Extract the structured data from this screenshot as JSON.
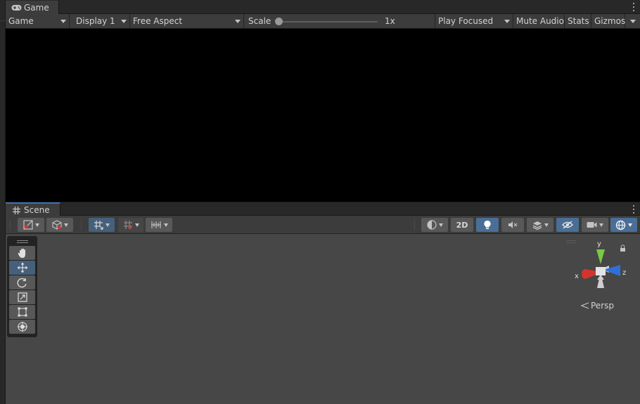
{
  "game": {
    "tab_label": "Game",
    "toolbar": {
      "view_mode": "Game",
      "display": "Display 1",
      "aspect": "Free Aspect",
      "scale_label": "Scale",
      "scale_value": "1x",
      "play_mode": "Play Focused",
      "mute_audio": "Mute Audio",
      "stats": "Stats",
      "gizmos": "Gizmos"
    }
  },
  "scene": {
    "tab_label": "Scene",
    "toolbar": {
      "mode_2d": "2D"
    },
    "tools": [
      "view-tool",
      "move-tool",
      "rotate-tool",
      "scale-tool",
      "rect-tool",
      "transform-tool"
    ],
    "active_tool": "move-tool",
    "gizmo": {
      "x_label": "x",
      "y_label": "y",
      "z_label": "z",
      "projection": "Persp"
    }
  },
  "colors": {
    "accent": "#46607c",
    "x_axis": "#d2352d",
    "y_axis": "#7ac943",
    "z_axis": "#2f6fd8"
  }
}
